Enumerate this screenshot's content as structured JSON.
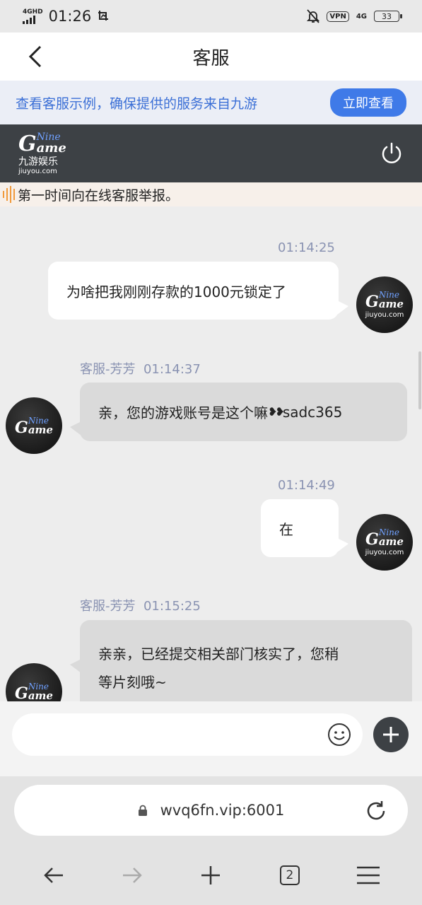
{
  "status_bar": {
    "network": "4GHD",
    "time": "01:26",
    "vpn": "VPN",
    "net4g": "4G",
    "battery": "33"
  },
  "header": {
    "title": "客服"
  },
  "notice": {
    "text": "查看客服示例，确保提供的服务来自九游",
    "button": "立即查看"
  },
  "brand": {
    "logo_letter": "G",
    "logo_nine": "Nine",
    "logo_ame": "ame",
    "logo_cn": "九游娱乐",
    "logo_url": "jiuyou.com"
  },
  "marquee": {
    "text": "第一时间向在线客服举报。"
  },
  "avatar": {
    "nine": "Nine",
    "ame": "ame",
    "url": "jiuyou.com"
  },
  "messages": [
    {
      "time": "01:14:25",
      "text": "为啥把我刚刚存款的1000元锁定了"
    },
    {
      "sender": "客服-芳芳",
      "time": "01:14:37",
      "text": "亲，您的游戏账号是这个嘛",
      "hearts": "❥❥",
      "account": "sadc365"
    },
    {
      "time": "01:14:49",
      "text": "在"
    },
    {
      "sender": "客服-芳芳",
      "time": "01:15:25",
      "line1": "亲亲，已经提交相关部门核实了，您稍",
      "line2": "等片刻哦~"
    }
  ],
  "browser": {
    "url": "wvq6fn.vip:6001",
    "tab_count": "2"
  }
}
